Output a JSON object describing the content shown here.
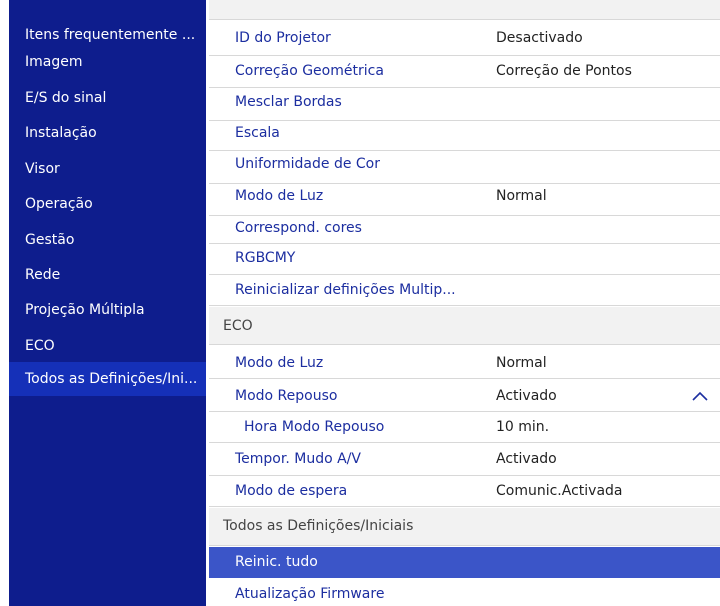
{
  "sidebar": {
    "items": [
      {
        "label": "Itens frequentemente ..."
      },
      {
        "label": "Imagem"
      },
      {
        "label": "E/S do sinal"
      },
      {
        "label": "Instalação"
      },
      {
        "label": "Visor"
      },
      {
        "label": "Operação"
      },
      {
        "label": "Gestão"
      },
      {
        "label": "Rede"
      },
      {
        "label": "Projeção Múltipla"
      },
      {
        "label": "ECO"
      },
      {
        "label": "Todos as Definições/Ini..."
      }
    ],
    "selected_index": 10
  },
  "content": {
    "multi_projection_rows": [
      {
        "label": "ID do Projetor",
        "value": "Desactivado"
      },
      {
        "label": "Correção Geométrica",
        "value": "Correção de Pontos"
      },
      {
        "label": "Mesclar Bordas",
        "value": ""
      },
      {
        "label": "Escala",
        "value": ""
      },
      {
        "label": "Uniformidade de Cor",
        "value": ""
      },
      {
        "label": "Modo de Luz",
        "value": "Normal"
      },
      {
        "label": "Correspond. cores",
        "value": ""
      },
      {
        "label": "RGBCMY",
        "value": ""
      },
      {
        "label": "Reinicializar definições Multip...",
        "value": ""
      }
    ],
    "eco_header": "ECO",
    "eco_rows": [
      {
        "label": "Modo de Luz",
        "value": "Normal"
      },
      {
        "label": "Modo Repouso",
        "value": "Activado"
      },
      {
        "label": "Hora Modo Repouso",
        "value": "10 min."
      },
      {
        "label": "Tempor. Mudo A/V",
        "value": "Activado"
      },
      {
        "label": "Modo de espera",
        "value": "Comunic.Activada"
      }
    ],
    "all_settings_header": "Todos as Definições/Iniciais",
    "all_settings_rows": [
      {
        "label": "Reinic. tudo"
      },
      {
        "label": "Atualização Firmware"
      }
    ]
  },
  "colors": {
    "sidebar_bg": "#0e1d8d",
    "sidebar_selected": "#1530b8",
    "label_blue": "#1c2ea0",
    "highlight_row": "#3b55c8"
  },
  "icons": {
    "expand": "chevron-up-icon"
  }
}
